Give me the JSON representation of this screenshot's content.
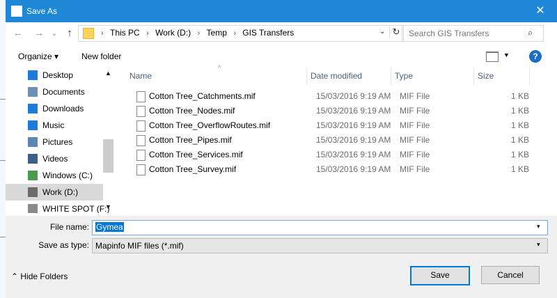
{
  "window": {
    "title": "Save As",
    "close_glyph": "✕"
  },
  "nav": {
    "back_glyph": "←",
    "forward_glyph": "→",
    "recent_glyph": "⌄",
    "up_glyph": "↑",
    "breadcrumb": [
      "This PC",
      "Work (D:)",
      "Temp",
      "GIS Transfers"
    ],
    "crumb_sep": "›",
    "refresh_glyph": "↻",
    "dropdown_glyph": "⌄",
    "search_placeholder": "Search GIS Transfers",
    "search_glyph": "⌕"
  },
  "toolbar": {
    "organize_label": "Organize ▾",
    "new_folder_label": "New folder",
    "view_dd_glyph": "▼",
    "help_glyph": "?"
  },
  "sidebar": {
    "items": [
      {
        "label": "Desktop",
        "icon": "desktop-icon",
        "color": "#1f7bd8"
      },
      {
        "label": "Documents",
        "icon": "documents-icon",
        "color": "#6e8fb5"
      },
      {
        "label": "Downloads",
        "icon": "downloads-icon",
        "color": "#1f7bd8"
      },
      {
        "label": "Music",
        "icon": "music-icon",
        "color": "#1f7bd8"
      },
      {
        "label": "Pictures",
        "icon": "pictures-icon",
        "color": "#5b86b8"
      },
      {
        "label": "Videos",
        "icon": "videos-icon",
        "color": "#3b5f8a"
      },
      {
        "label": "Windows (C:)",
        "icon": "drive-icon",
        "color": "#4c9b4c"
      },
      {
        "label": "Work (D:)",
        "icon": "drive-icon",
        "color": "#6b6b6b"
      },
      {
        "label": "WHITE SPOT (F:)",
        "icon": "drive-icon",
        "color": "#8a8a8a"
      }
    ],
    "scroll_up_glyph": "▲",
    "scroll_down_glyph": "▼"
  },
  "files": {
    "headers": {
      "name": "Name",
      "date": "Date modified",
      "type": "Type",
      "size": "Size"
    },
    "sort_glyph": "^",
    "rows": [
      {
        "name": "Cotton Tree_Catchments.mif",
        "date": "15/03/2016 9:19 AM",
        "type": "MIF File",
        "size": "1 KB"
      },
      {
        "name": "Cotton Tree_Nodes.mif",
        "date": "15/03/2016 9:19 AM",
        "type": "MIF File",
        "size": "1 KB"
      },
      {
        "name": "Cotton Tree_OverflowRoutes.mif",
        "date": "15/03/2016 9:19 AM",
        "type": "MIF File",
        "size": "1 KB"
      },
      {
        "name": "Cotton Tree_Pipes.mif",
        "date": "15/03/2016 9:19 AM",
        "type": "MIF File",
        "size": "1 KB"
      },
      {
        "name": "Cotton Tree_Services.mif",
        "date": "15/03/2016 9:19 AM",
        "type": "MIF File",
        "size": "1 KB"
      },
      {
        "name": "Cotton Tree_Survey.mif",
        "date": "15/03/2016 9:19 AM",
        "type": "MIF File",
        "size": "1 KB"
      }
    ]
  },
  "form": {
    "filename_label": "File name:",
    "filename_value": "Gymea",
    "savetype_label": "Save as type:",
    "savetype_value": "Mapinfo MIF files (*.mif)",
    "dropdown_glyph": "▾"
  },
  "footer": {
    "hide_folders_label": "⌃  Hide Folders",
    "save_label": "Save",
    "cancel_label": "Cancel"
  }
}
